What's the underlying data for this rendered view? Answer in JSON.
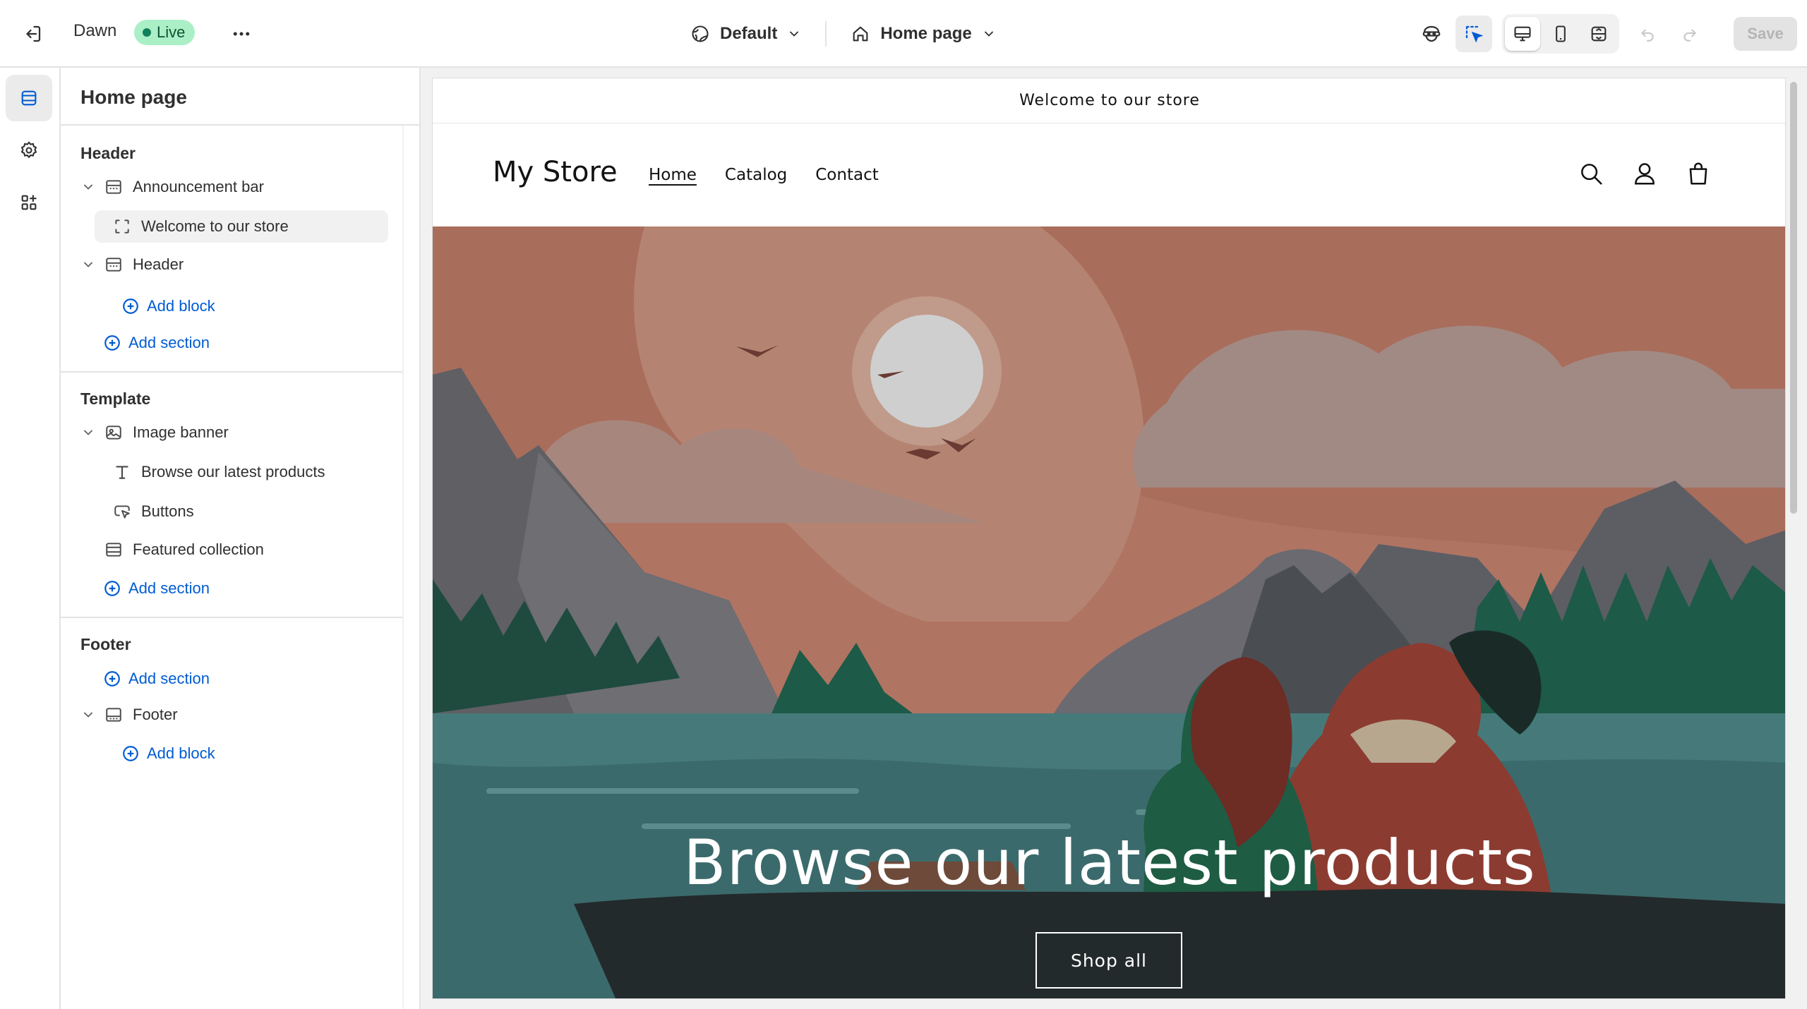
{
  "topbar": {
    "theme_name": "Dawn",
    "status_badge": "Live",
    "theme_dropdown": "Default",
    "page_dropdown": "Home page",
    "save_label": "Save",
    "icons": [
      "exit-icon",
      "more-icon",
      "globe-icon",
      "home-icon",
      "chevron-down-icon",
      "preview-eye-icon",
      "inspector-icon",
      "desktop-icon",
      "mobile-icon",
      "fullscreen-icon",
      "undo-icon",
      "redo-icon"
    ]
  },
  "rail": {
    "items": [
      {
        "name": "sections",
        "icon": "sections-icon",
        "selected": true
      },
      {
        "name": "theme-settings",
        "icon": "gear-icon",
        "selected": false
      },
      {
        "name": "apps",
        "icon": "apps-icon",
        "selected": false
      }
    ]
  },
  "sidebar": {
    "title": "Home page",
    "header_group": {
      "title": "Header",
      "announcement_bar": "Announcement bar",
      "announcement_block": "Welcome to our store",
      "header": "Header",
      "add_block": "Add block",
      "add_section": "Add section"
    },
    "template_group": {
      "title": "Template",
      "image_banner": "Image banner",
      "heading_block": "Browse our latest products",
      "buttons_block": "Buttons",
      "featured_collection": "Featured collection",
      "add_section": "Add section"
    },
    "footer_group": {
      "title": "Footer",
      "add_section": "Add section",
      "footer": "Footer",
      "add_block": "Add block"
    }
  },
  "preview": {
    "announcement": "Welcome to our store",
    "logo": "My Store",
    "nav": [
      "Home",
      "Catalog",
      "Contact"
    ],
    "header_icons": [
      "search-icon",
      "account-icon",
      "cart-icon"
    ],
    "banner_heading": "Browse our latest products",
    "banner_button": "Shop all"
  },
  "colors": {
    "accent_blue": "#005bd3",
    "live_badge_bg": "#abefc6",
    "live_badge_text": "#0c5132"
  }
}
